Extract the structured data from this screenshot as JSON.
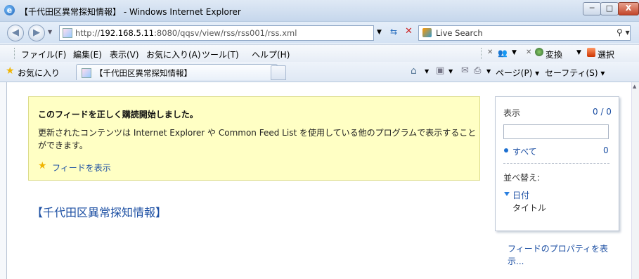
{
  "window": {
    "title": "【千代田区異常探知情報】 - Windows Internet Explorer",
    "minimize": "─",
    "maximize": "□",
    "close": "X"
  },
  "address": {
    "url_prefix": "http://",
    "url_host": "192.168.5.11",
    "url_rest": ":8080/qqsv/view/rss/rss001/rss.xml"
  },
  "search": {
    "placeholder": "Live Search",
    "go_icon": "search-icon"
  },
  "menu": {
    "file": "ファイル(F)",
    "edit": "編集(E)",
    "view": "表示(V)",
    "favorites": "お気に入り(A)",
    "tools": "ツール(T)",
    "help": "ヘルプ(H)"
  },
  "toolbar": {
    "convert": "変換",
    "select": "選択"
  },
  "favbar": {
    "favorites": "お気に入り",
    "tab_label": "【千代田区異常探知情報】",
    "page": "ページ(P) ▾",
    "safety": "セーフティ(S) ▾"
  },
  "notice": {
    "title": "このフィードを正しく購読開始しました。",
    "body": "更新されたコンテンツは Internet Explorer や Common Feed List を使用している他のプログラムで表示することができます。",
    "link": "フィードを表示"
  },
  "feed": {
    "title": "【千代田区異常探知情報】"
  },
  "sidepanel": {
    "show_label": "表示",
    "count": "0 / 0",
    "all_label": "すべて",
    "all_count": "0",
    "sort_label": "並べ替え:",
    "sort_date": "日付",
    "sort_title": "タイトル"
  },
  "properties_link": "フィードのプロパティを表示..."
}
